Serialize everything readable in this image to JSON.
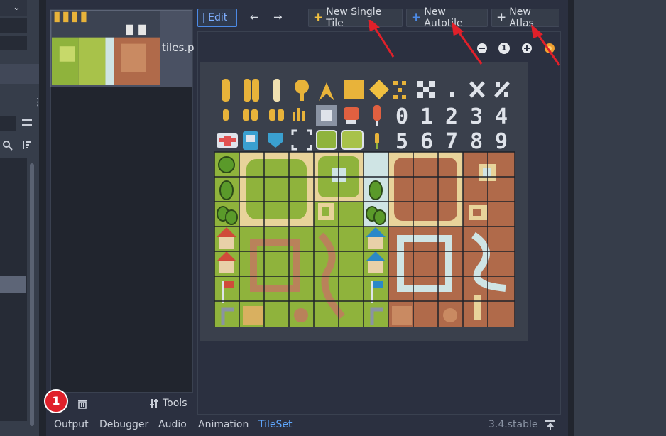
{
  "toolbar": {
    "edit_label": "Edit",
    "new_single_tile_label": "New Single Tile",
    "new_autotile_label": "New Autotile",
    "new_atlas_label": "New Atlas"
  },
  "tile_list": {
    "item_name": "tiles.p",
    "tools_label": "Tools"
  },
  "zoom": {
    "reset_label": "1"
  },
  "atlas": {
    "digits_row1": [
      "0",
      "1",
      "2",
      "3",
      "4"
    ],
    "digits_row2": [
      "5",
      "6",
      "7",
      "8",
      "9"
    ]
  },
  "badge": {
    "number": "1"
  },
  "bottom_tabs": [
    "Output",
    "Debugger",
    "Audio",
    "Animation",
    "TileSet"
  ],
  "version": "3.4.stable",
  "colors": {
    "accent": "#4c8ae6",
    "active_tab": "#5fa8ff",
    "badge": "#e0202a",
    "grass": "#8fb33c",
    "dirt": "#b06a4a"
  }
}
